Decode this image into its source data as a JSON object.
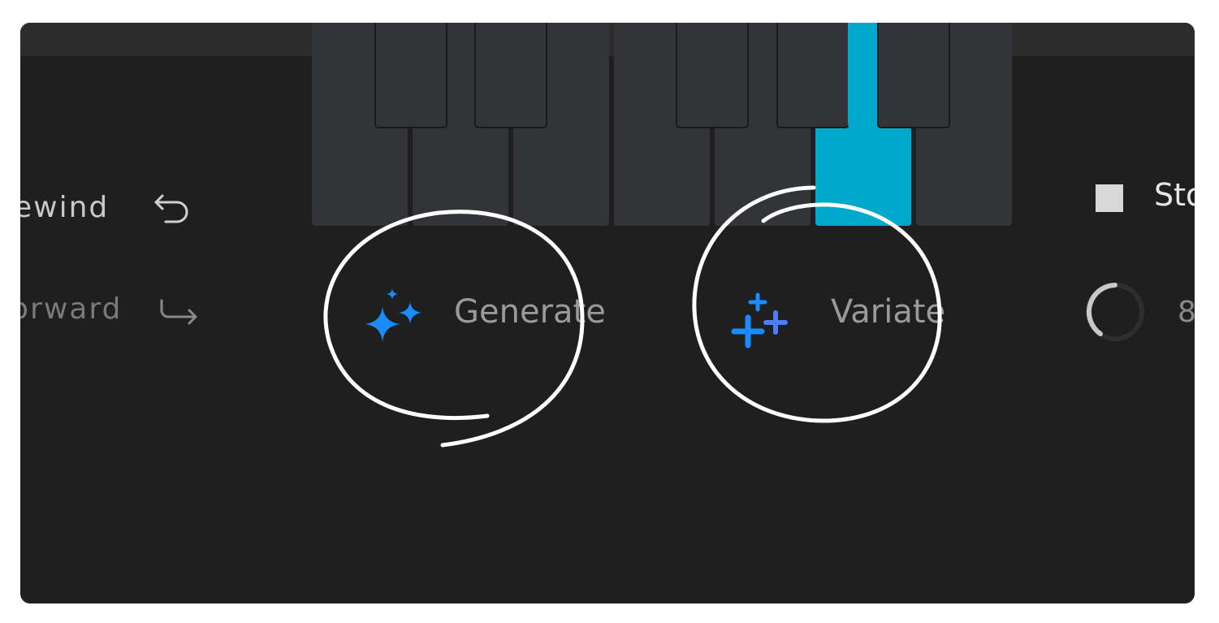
{
  "transport": {
    "rewind_label": "ewind",
    "forward_label": "orward",
    "stop_label": "Sto",
    "tempo_value": "8"
  },
  "actions": {
    "generate_label": "Generate",
    "variate_label": "Variate"
  },
  "keyboard": {
    "active_key": "white-key-6"
  },
  "colors": {
    "accent": "#00a9cc",
    "generate_icon": "#1a8cff",
    "variate_icon": "#4f7bff",
    "panel_bg": "#1f1f1f",
    "annotation": "#ffffff"
  },
  "icons": {
    "rewind": "undo-arrow-icon",
    "forward": "redo-arrow-icon",
    "generate": "sparkles-icon",
    "variate": "plus-cluster-icon",
    "stop": "stop-square-icon",
    "tempo": "dial-icon"
  }
}
